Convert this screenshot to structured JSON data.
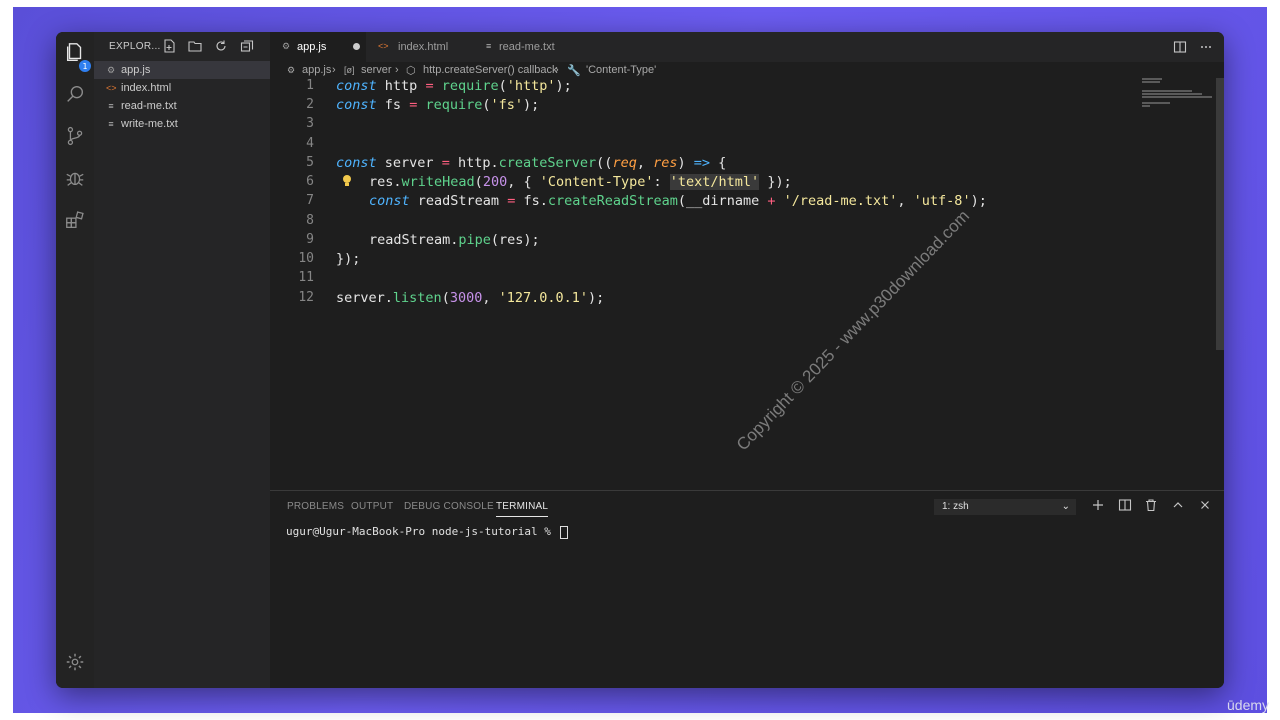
{
  "activity_bar": {
    "icons": [
      "files-icon",
      "search-icon",
      "source-control-icon",
      "debug-icon",
      "extensions-icon",
      "settings-gear-icon"
    ],
    "explorer_badge": "1"
  },
  "sidebar": {
    "title": "EXPLOR...",
    "files": [
      {
        "name": "app.js",
        "icon": "gear-file-icon",
        "active": true
      },
      {
        "name": "index.html",
        "icon": "html-icon",
        "active": false
      },
      {
        "name": "read-me.txt",
        "icon": "text-file-icon",
        "active": false
      },
      {
        "name": "write-me.txt",
        "icon": "text-file-icon",
        "active": false
      }
    ]
  },
  "tabs": [
    {
      "label": "app.js",
      "active": true,
      "dirty": true
    },
    {
      "label": "index.html",
      "active": false,
      "dirty": false
    },
    {
      "label": "read-me.txt",
      "active": false,
      "dirty": false
    }
  ],
  "breadcrumb": {
    "file": "app.js",
    "scope1": "server",
    "scope2": "http.createServer() callback",
    "scope3": "'Content-Type'"
  },
  "editor": {
    "line_numbers": [
      "1",
      "2",
      "3",
      "4",
      "5",
      "6",
      "7",
      "8",
      "9",
      "10",
      "11",
      "12"
    ],
    "code": {
      "l1": [
        "const",
        "http",
        "=",
        "require",
        "(",
        "'http'",
        ");"
      ],
      "l2": [
        "const",
        "fs",
        "=",
        "require",
        "(",
        "'fs'",
        ");"
      ],
      "l5": [
        "const",
        "server",
        "=",
        "http.",
        "createServer",
        "((",
        "req",
        ", ",
        "res",
        ") ",
        "=>",
        " {"
      ],
      "l6": [
        "res.",
        "writeHead",
        "(",
        "200",
        ", { ",
        "'Content-Type'",
        ": ",
        "'text/html'",
        " });"
      ],
      "l7": [
        "const",
        "readStream",
        "=",
        "fs.",
        "createReadStream",
        "(__dirname ",
        "+",
        " ",
        "'/read-me.txt'",
        ", ",
        "'utf-8'",
        ");"
      ],
      "l9": [
        "readStream.",
        "pipe",
        "(res);"
      ],
      "l10": [
        "});"
      ],
      "l12": [
        "server.",
        "listen",
        "(",
        "3000",
        ", ",
        "'127.0.0.1'",
        ");"
      ]
    },
    "watermark": "Copyright © 2025 - www.p30download.com"
  },
  "panel": {
    "tabs": [
      "PROBLEMS",
      "OUTPUT",
      "DEBUG CONSOLE",
      "TERMINAL"
    ],
    "active_tab": "TERMINAL",
    "terminal_select": "1: zsh",
    "prompt": "ugur@Ugur-MacBook-Pro node-js-tutorial % "
  },
  "overlay": {
    "brand": "ūdemy"
  },
  "colors": {
    "background": "#5a4fd8",
    "keyword": "#4fb4ff",
    "function": "#5fd38d",
    "string": "#f4e79c",
    "number": "#c792ea",
    "operator": "#ff5f80",
    "param": "#ff9f43"
  }
}
